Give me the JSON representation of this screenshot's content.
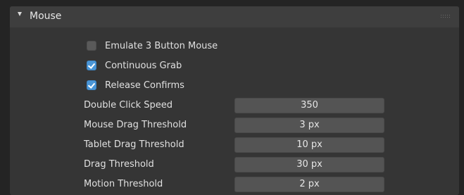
{
  "panel": {
    "title": "Mouse",
    "expanded": true,
    "drag_handle_icon": "grip-dots-icon"
  },
  "checkboxes": [
    {
      "label": "Emulate 3 Button Mouse",
      "checked": false
    },
    {
      "label": "Continuous Grab",
      "checked": true
    },
    {
      "label": "Release Confirms",
      "checked": true
    }
  ],
  "fields": [
    {
      "label": "Double Click Speed",
      "value": "350"
    },
    {
      "label": "Mouse Drag Threshold",
      "value": "3 px"
    },
    {
      "label": "Tablet Drag Threshold",
      "value": "10 px"
    },
    {
      "label": "Drag Threshold",
      "value": "30 px"
    },
    {
      "label": "Motion Threshold",
      "value": "2 px"
    }
  ],
  "colors": {
    "accent": "#4a95d6",
    "panel_background": "#353535",
    "header_background": "#3e3e3e",
    "field_background": "#545454",
    "text": "#e6e6e6"
  }
}
